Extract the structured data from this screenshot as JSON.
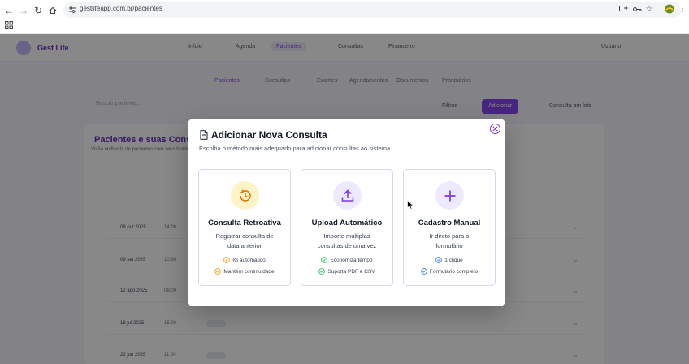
{
  "browser": {
    "url": "gestlifeapp.com.br/pacientes"
  },
  "app": {
    "brand": "Gest Life",
    "nav": [
      "Início",
      "Agenda",
      "Pacientes",
      "Consultas",
      "Financeiro"
    ],
    "user": "Usuário",
    "subtabs": [
      "Pacientes",
      "Consultas",
      "Exames",
      "Agendamentos",
      "Documentos",
      "Prontuários"
    ],
    "search_placeholder": "Buscar paciente...",
    "buttons": [
      "Filtros",
      "Adicionar",
      "Consulta em lote"
    ],
    "panel_title": "Pacientes e suas Consultas",
    "panel_subtitle": "Visão unificada de pacientes com seus históricos",
    "rows": [
      {
        "date": "08 out 2025",
        "time": "14:00"
      },
      {
        "date": "09 set 2025",
        "time": "10:30"
      },
      {
        "date": "12 ago 2025",
        "time": "09:00"
      },
      {
        "date": "18 jul 2025",
        "time": "15:00"
      },
      {
        "date": "22 jun 2025",
        "time": "11:00"
      }
    ]
  },
  "modal": {
    "title": "Adicionar Nova Consulta",
    "subtitle": "Escolha o método mais adequado para adicionar consultas ao sistema",
    "cards": [
      {
        "title": "Consulta Retroativa",
        "desc_line1": "Registrar consulta de",
        "desc_line2": "data anterior",
        "feature1": "IG automático",
        "feature2": "Mantém continuidade",
        "accent": "#f59e0b",
        "icon_bg": "#fef3c7",
        "icon": "history-icon"
      },
      {
        "title": "Upload Automático",
        "desc_line1": "Importe múltiplas",
        "desc_line2": "consultas de uma vez",
        "feature1": "Economiza tempo",
        "feature2": "Suporta PDF e CSV",
        "accent": "#22c55e",
        "icon_bg": "#ede9fe",
        "icon": "upload-icon"
      },
      {
        "title": "Cadastro Manual",
        "desc_line1": "Ir direto para o",
        "desc_line2": "formulário",
        "feature1": "1 clique",
        "feature2": "Formulário completo",
        "accent": "#3b82f6",
        "icon_bg": "#ede9fe",
        "icon": "plus-icon"
      }
    ]
  }
}
